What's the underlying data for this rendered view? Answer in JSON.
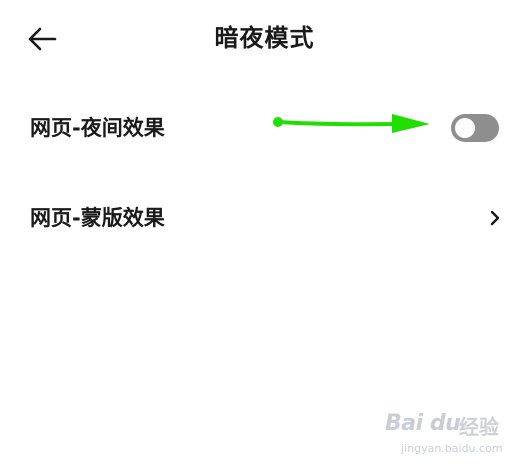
{
  "header": {
    "title": "暗夜模式",
    "back_icon": "arrow-left-icon"
  },
  "settings": [
    {
      "label": "网页-夜间效果",
      "control": "toggle",
      "toggle_on": false,
      "toggle_track_color": "#8e8e8e"
    },
    {
      "label": "网页-蒙版效果",
      "control": "chevron",
      "chevron_icon": "chevron-right-icon"
    }
  ],
  "annotation": {
    "arrow_color": "#22dd00",
    "arrow_icon": "green-arrow-icon"
  },
  "watermark": {
    "logo": "Bai du",
    "text": "经验",
    "url": "jingyan.baidu.com",
    "color": "#c9ced6"
  }
}
